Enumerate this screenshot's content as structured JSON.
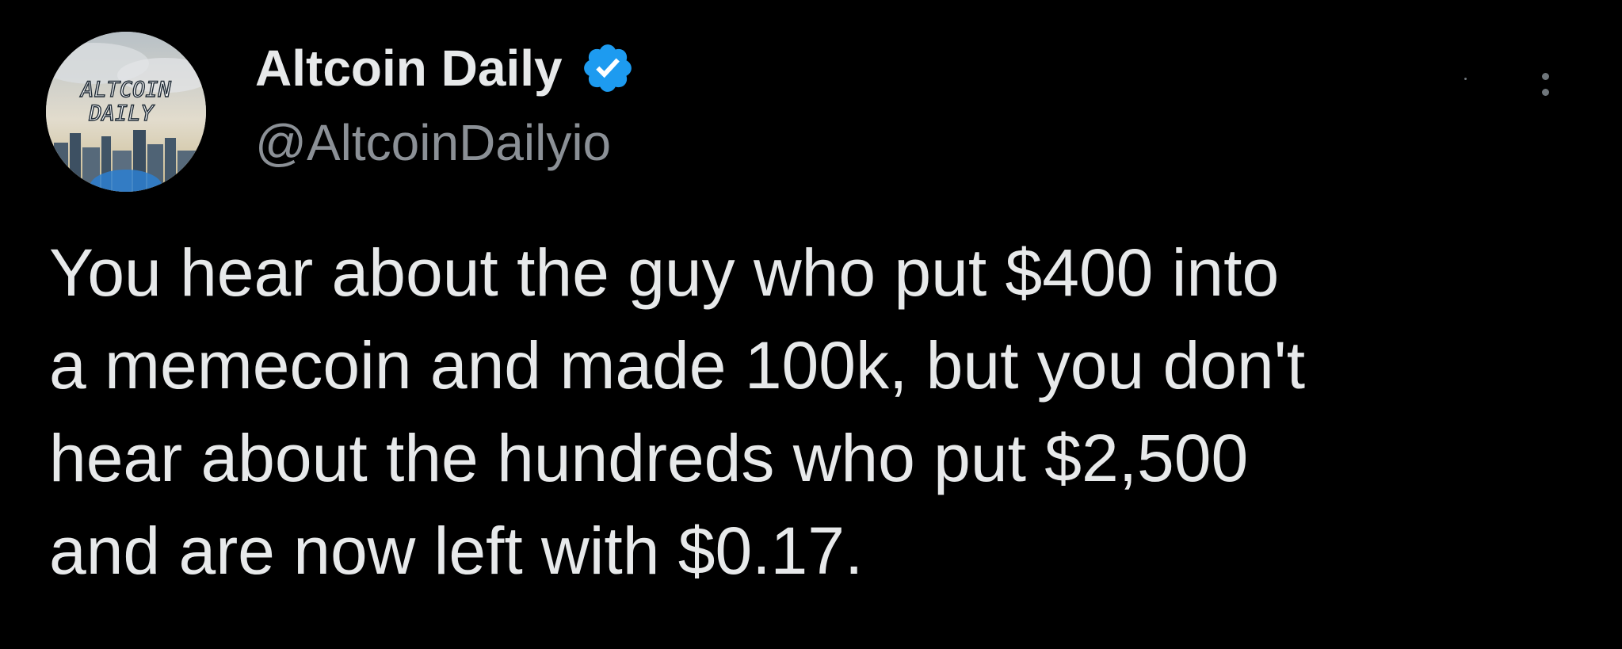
{
  "tweet": {
    "author": {
      "display_name": "Altcoin Daily",
      "handle": "@AltcoinDailyio",
      "verified": true,
      "avatar_text_line1": "ALTCOIN",
      "avatar_text_line2": "DAILY"
    },
    "text": "You hear about the guy who put $400 into\na memecoin and made 100k, but you don't\nhear about the hundreds who put $2,500\nand are now left with $0.17.",
    "more_icon": "ellipsis-icon"
  },
  "colors": {
    "background": "#000000",
    "text_primary": "#e7e9ea",
    "text_secondary": "#8b9096",
    "verified_badge": "#1d9bf0"
  }
}
